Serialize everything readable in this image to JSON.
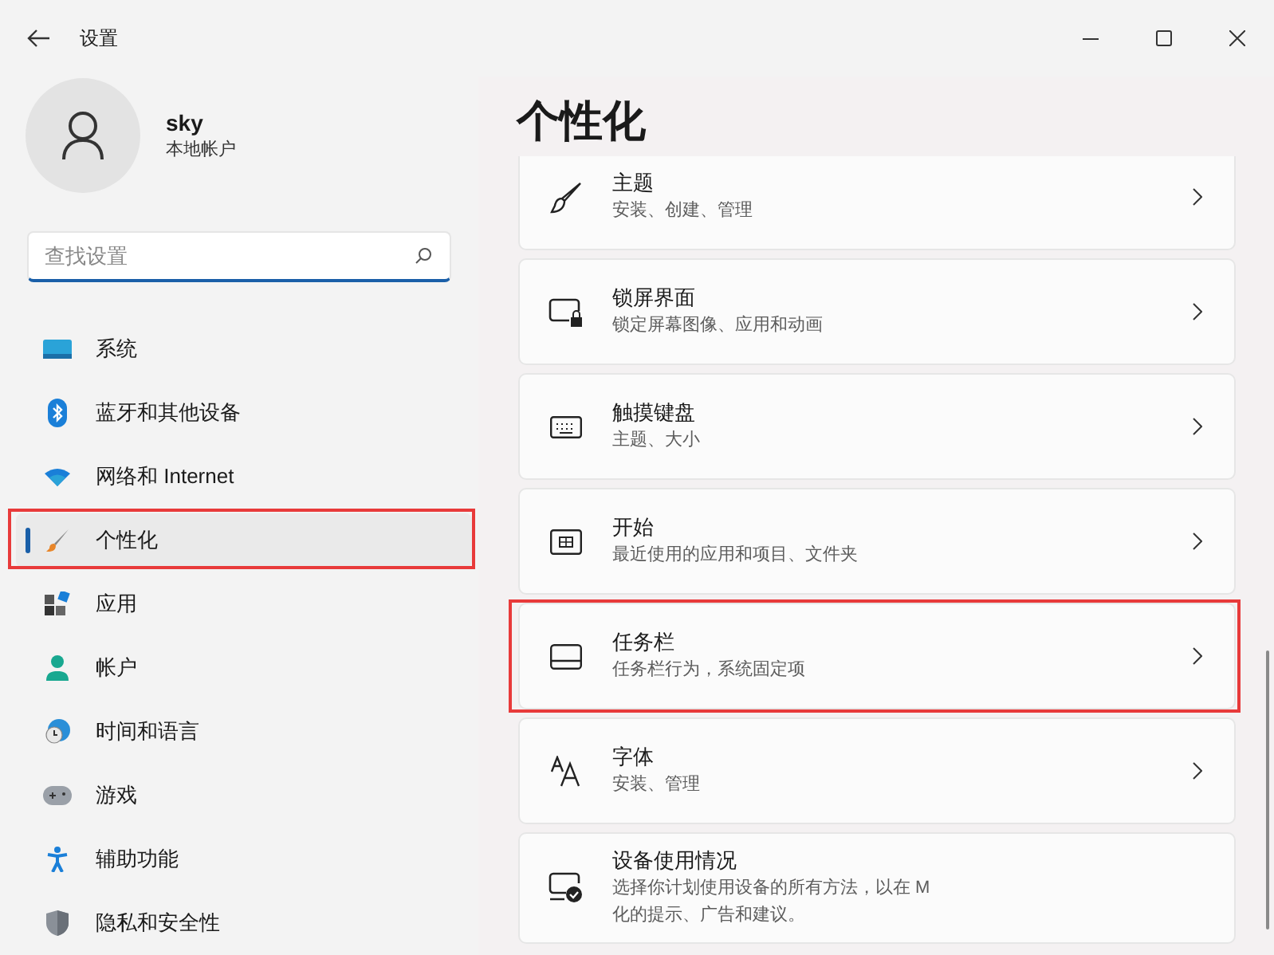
{
  "window": {
    "title": "设置"
  },
  "account": {
    "name": "sky",
    "type": "本地帐户"
  },
  "search": {
    "placeholder": "查找设置"
  },
  "nav": [
    {
      "label": "系统",
      "selected": false,
      "highlighted": false
    },
    {
      "label": "蓝牙和其他设备",
      "selected": false,
      "highlighted": false
    },
    {
      "label": "网络和 Internet",
      "selected": false,
      "highlighted": false
    },
    {
      "label": "个性化",
      "selected": true,
      "highlighted": true
    },
    {
      "label": "应用",
      "selected": false,
      "highlighted": false
    },
    {
      "label": "帐户",
      "selected": false,
      "highlighted": false
    },
    {
      "label": "时间和语言",
      "selected": false,
      "highlighted": false
    },
    {
      "label": "游戏",
      "selected": false,
      "highlighted": false
    },
    {
      "label": "辅助功能",
      "selected": false,
      "highlighted": false
    },
    {
      "label": "隐私和安全性",
      "selected": false,
      "highlighted": false
    }
  ],
  "page": {
    "title": "个性化"
  },
  "cards": [
    {
      "title": "主题",
      "description": "安装、创建、管理",
      "highlighted": false
    },
    {
      "title": "锁屏界面",
      "description": "锁定屏幕图像、应用和动画",
      "highlighted": false
    },
    {
      "title": "触摸键盘",
      "description": "主题、大小",
      "highlighted": false
    },
    {
      "title": "开始",
      "description": "最近使用的应用和项目、文件夹",
      "highlighted": false
    },
    {
      "title": "任务栏",
      "description": "任务栏行为，系统固定项",
      "highlighted": true
    },
    {
      "title": "字体",
      "description": "安装、管理",
      "highlighted": false
    },
    {
      "title": "设备使用情况",
      "description": "选择你计划使用设备的所有方法，以在 M\n化的提示、广告和建议。",
      "highlighted": false
    }
  ]
}
